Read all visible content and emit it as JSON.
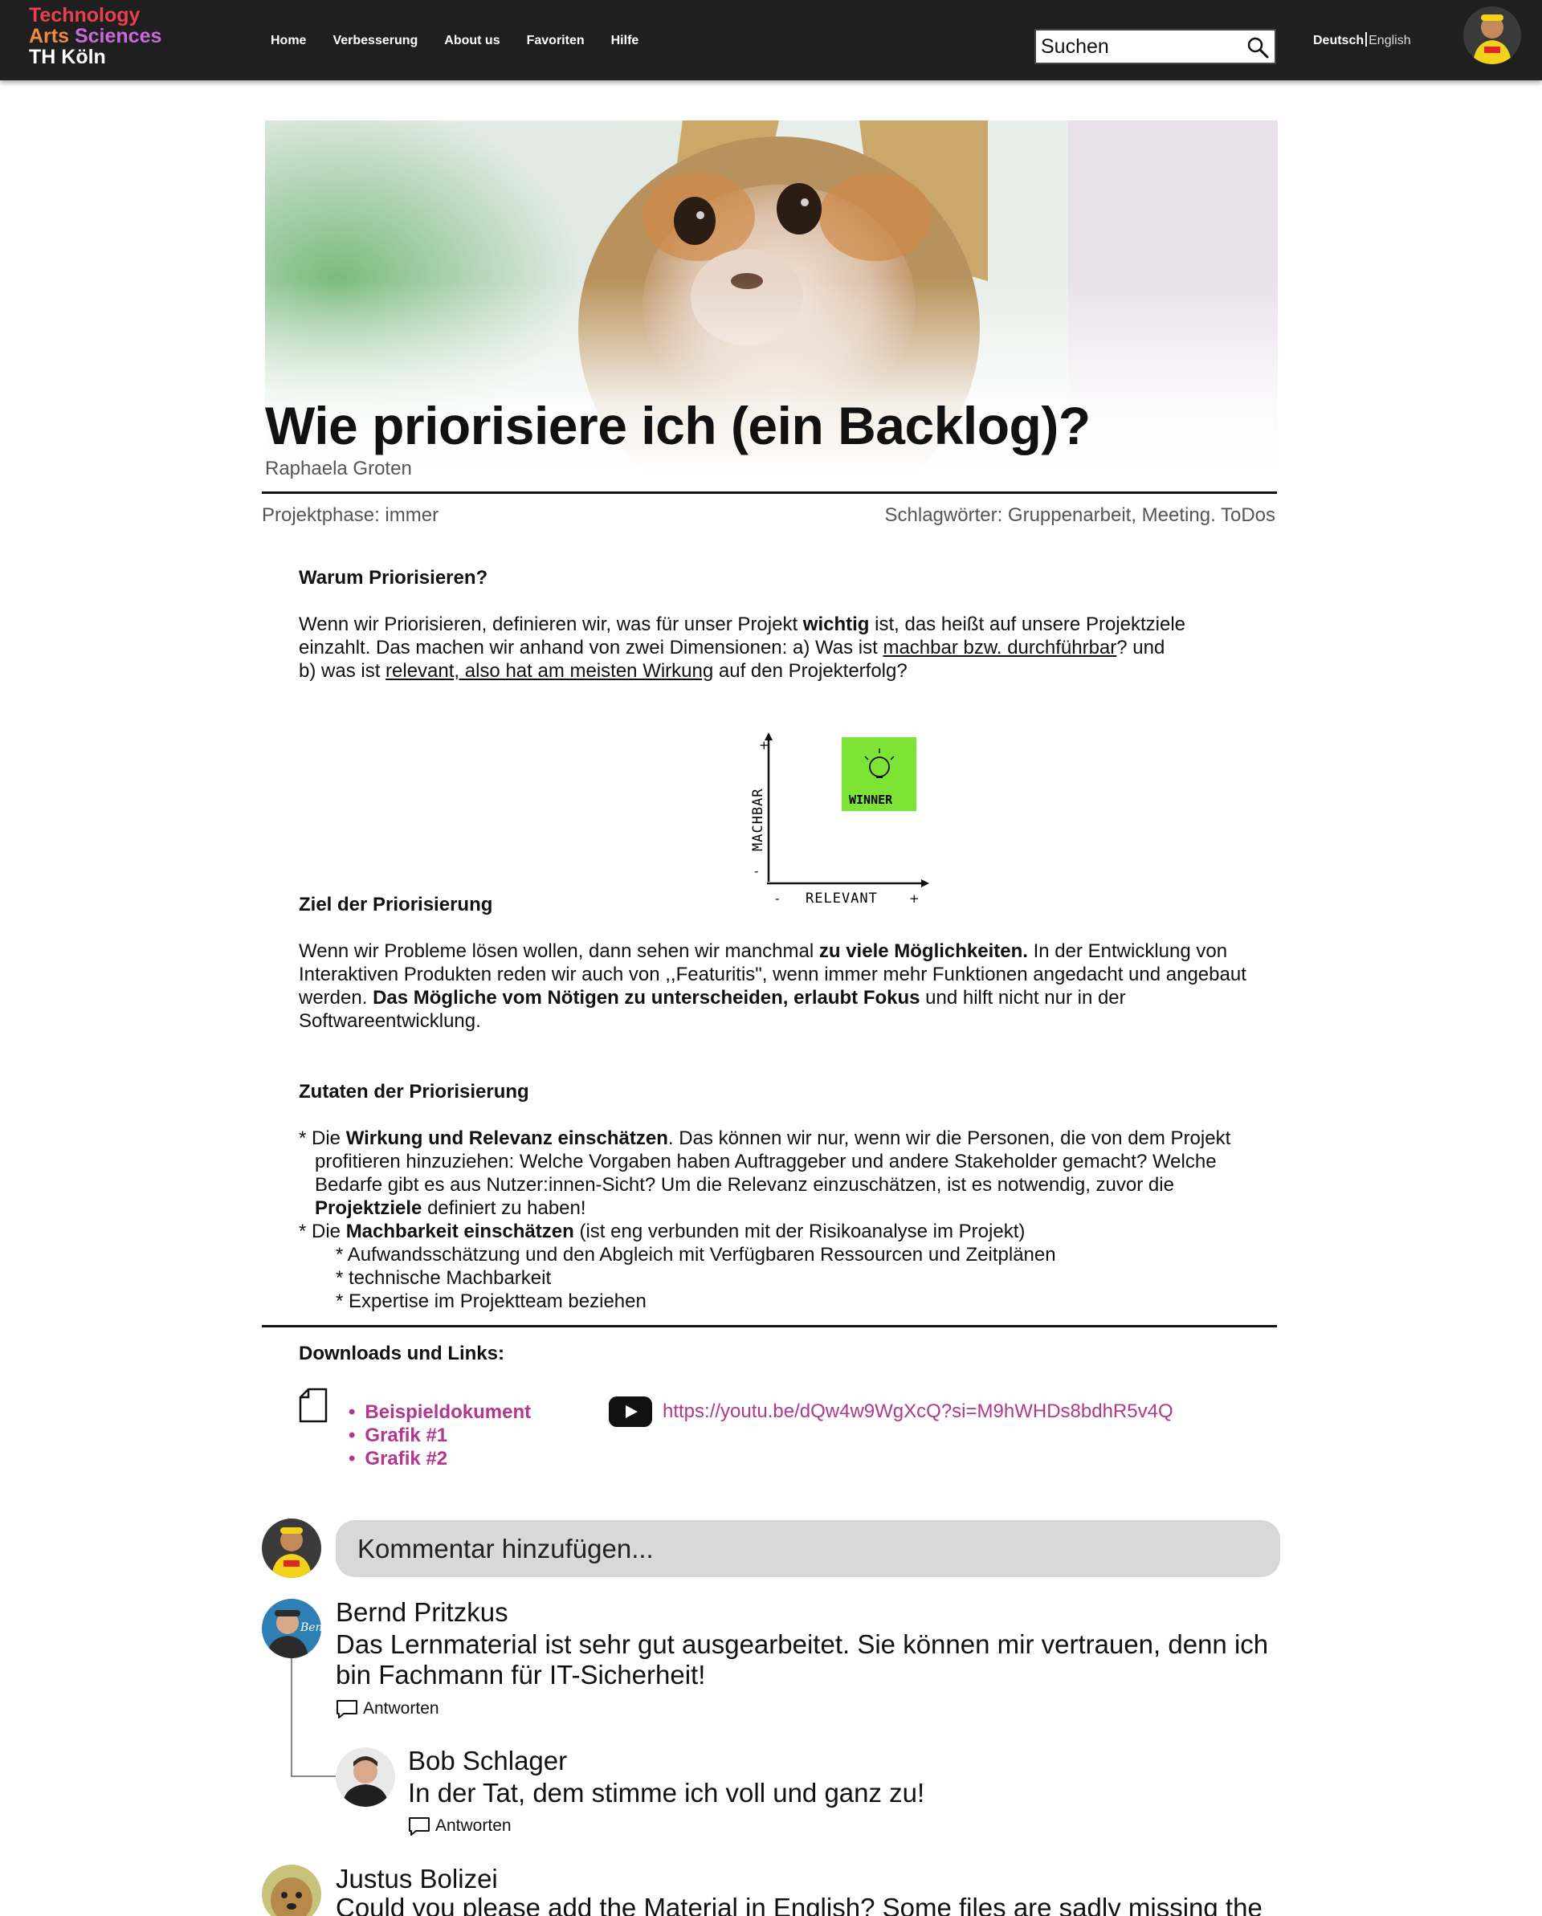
{
  "header": {
    "logo": {
      "line1": "Technology",
      "line2_a": "Arts ",
      "line2_b": "Sciences",
      "line3": "TH Köln"
    },
    "nav": [
      "Home",
      "Verbesserung",
      "About us",
      "Favoriten",
      "Hilfe"
    ],
    "search_placeholder": "Suchen",
    "lang_active": "Deutsch",
    "lang_other": "English"
  },
  "article": {
    "title": "Wie priorisiere ich (ein Backlog)?",
    "author": "Raphaela Groten",
    "phase": "Projektphase: immer",
    "tags": "Schlagwörter: Gruppenarbeit, Meeting. ToDos",
    "s1_heading": "Warum Priorisieren?",
    "s1_p_a": "Wenn wir Priorisieren, definieren wir, was für unser Projekt ",
    "s1_p_b": "wichtig",
    "s1_p_c": " ist, das heißt auf unsere Projektziele einzahlt. Das machen wir anhand von zwei Dimensionen: a) Was ist ",
    "s1_p_d": "machbar bzw. durchführbar",
    "s1_p_e": "? und",
    "s1_p_f": "b) was ist ",
    "s1_p_g": "relevant, also hat am meisten Wirkung",
    "s1_p_h": " auf den Projekterfolg?",
    "diagram": {
      "y_label": "MACHBAR",
      "x_label": "RELEVANT",
      "note": "WINNER",
      "plus": "+",
      "minus": "-"
    },
    "s2_heading": "Ziel der Priorisierung",
    "s2_p_a": "Wenn wir Probleme lösen wollen, dann sehen wir manchmal ",
    "s2_p_b": "zu viele Möglichkeiten.",
    "s2_p_c": " In der Entwicklung von Interaktiven Produkten reden wir auch von ,,Featuritis\", wenn immer mehr Funktionen angedacht und angebaut werden. ",
    "s2_p_d": "Das Mögliche vom Nötigen zu unterscheiden, erlaubt Fokus",
    "s2_p_e": " und hilft nicht nur in der Softwareentwicklung.",
    "s3_heading": "Zutaten der Priorisierung",
    "s3_b1_a": "* Die ",
    "s3_b1_b": "Wirkung und Relevanz einschätzen",
    "s3_b1_c": ". Das können wir nur, wenn wir die Personen, die von dem Projekt profitieren hinzuziehen: Welche Vorgaben haben Auftraggeber und andere Stakeholder gemacht? Welche Bedarfe gibt es aus Nutzer:innen-Sicht? Um die Relevanz einzuschätzen, ist es notwendig, zuvor die ",
    "s3_b1_d": "Projektziele",
    "s3_b1_e": " definiert zu haben!",
    "s3_b2_a": "* Die ",
    "s3_b2_b": "Machbarkeit einschätzen",
    "s3_b2_c": " (ist eng verbunden mit der Risikoanalyse im Projekt)",
    "s3_sub": [
      "* Aufwandsschätzung und den Abgleich mit Verfügbaren Ressourcen und Zeitplänen",
      "* technische Machbarkeit",
      "* Expertise im Projektteam beziehen"
    ]
  },
  "downloads": {
    "title": "Downloads und Links:",
    "items": [
      "Beispieldokument",
      "Grafik #1",
      "Grafik #2"
    ],
    "youtube_url": "https://youtu.be/dQw4w9WgXcQ?si=M9hWHDs8bdhR5v4Q"
  },
  "comments": {
    "placeholder": "Kommentar hinzufügen...",
    "reply_label": "Antworten",
    "items": [
      {
        "name": "Bernd Pritzkus",
        "text": "Das Lernmaterial ist sehr gut ausgearbeitet. Sie können mir vertrauen, denn ich bin Fachmann für IT-Sicherheit!"
      },
      {
        "name": "Bob Schlager",
        "text": "In der Tat, dem stimme ich voll und ganz zu!"
      },
      {
        "name": "Justus Bolizei",
        "text": "Could you please add the Material in English? Some files are sadly missing the"
      }
    ]
  },
  "colors": {
    "topbar": "#1f1f1f",
    "accent": "#b2378f",
    "note": "#7de335"
  }
}
